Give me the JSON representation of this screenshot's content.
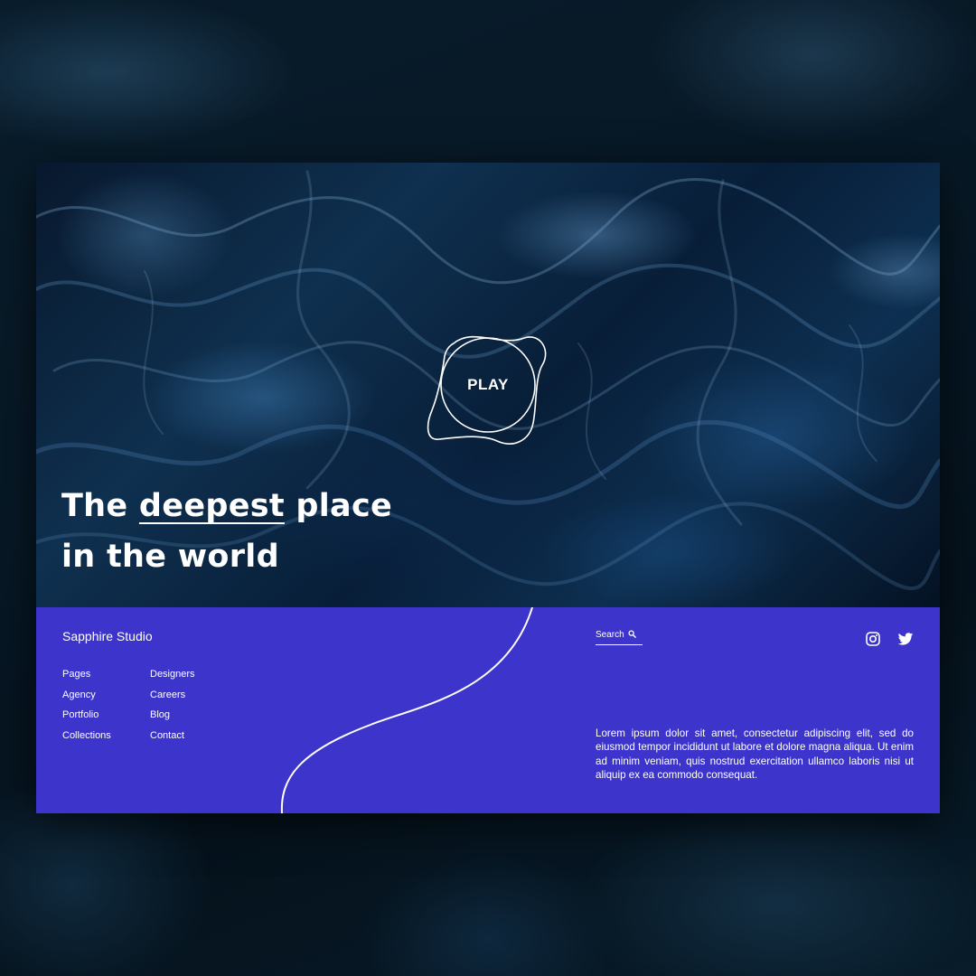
{
  "hero": {
    "play_label": "PLAY",
    "headline_prefix": "The ",
    "headline_highlight": "deepest",
    "headline_suffix": " place",
    "headline_line2": "in the world"
  },
  "footer": {
    "brand": "Sapphire Studio",
    "nav_col1": [
      "Pages",
      "Agency",
      "Portfolio",
      "Collections"
    ],
    "nav_col2": [
      "Designers",
      "Careers",
      "Blog",
      "Contact"
    ],
    "search_label": "Search",
    "social_icons": [
      "instagram-icon",
      "twitter-icon"
    ],
    "body_text": "Lorem ipsum dolor sit amet, consectetur adipiscing elit, sed do eiusmod tempor incididunt ut labore et dolore magna aliqua. Ut enim ad minim veniam, quis nostrud exercitation ullamco laboris nisi ut aliquip ex ea commodo consequat."
  },
  "colors": {
    "footer_bg": "#3d35cb",
    "text": "#ffffff",
    "hero_dark": "#0a1d33"
  }
}
